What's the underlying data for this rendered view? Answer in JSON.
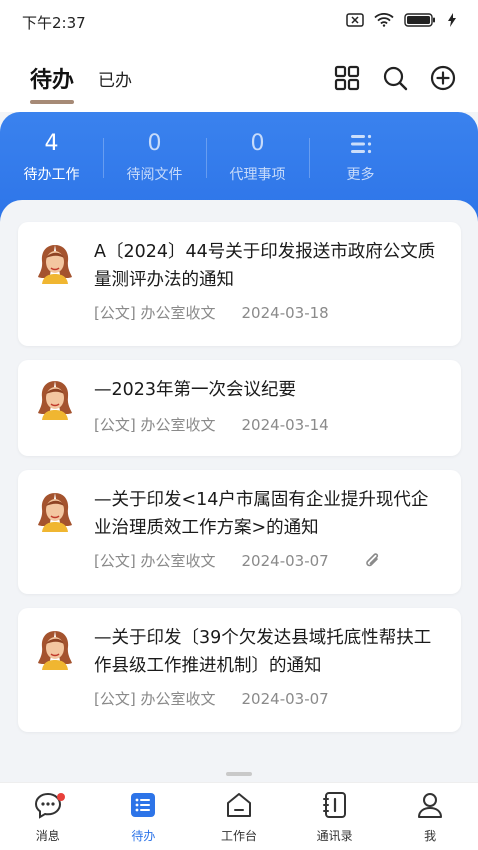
{
  "status": {
    "time": "下午2:37",
    "battery": "100"
  },
  "header": {
    "active_tab": "待办",
    "other_tab": "已办"
  },
  "stats": [
    {
      "value": "4",
      "label": "待办工作",
      "active": true
    },
    {
      "value": "0",
      "label": "待阅文件",
      "active": false
    },
    {
      "value": "0",
      "label": "代理事项",
      "active": false
    },
    {
      "value": "",
      "label": "更多",
      "active": false
    }
  ],
  "items": [
    {
      "title": "A〔2024〕44号关于印发报送市政府公文质量测评办法的通知",
      "type": "[公文]",
      "source": "办公室收文",
      "date": "2024-03-18",
      "attachment": false
    },
    {
      "title": "—2023年第一次会议纪要",
      "type": "[公文]",
      "source": "办公室收文",
      "date": "2024-03-14",
      "attachment": false
    },
    {
      "title": "—关于印发<14户市属固有企业提升现代企业治理质效工作方案>的通知",
      "type": "[公文]",
      "source": "办公室收文",
      "date": "2024-03-07",
      "attachment": true
    },
    {
      "title": "—关于印发〔39个欠发达县域托底性帮扶工作县级工作推进机制〕的通知",
      "type": "[公文]",
      "source": "办公室收文",
      "date": "2024-03-07",
      "attachment": false
    }
  ],
  "nav": [
    {
      "label": "消息",
      "icon": "chat-icon",
      "active": false
    },
    {
      "label": "待办",
      "icon": "list-icon",
      "active": true
    },
    {
      "label": "工作台",
      "icon": "home-icon",
      "active": false
    },
    {
      "label": "通讯录",
      "icon": "contacts-icon",
      "active": false
    },
    {
      "label": "我",
      "icon": "user-icon",
      "active": false
    }
  ],
  "colors": {
    "primary": "#2d74e8",
    "badge": "#e8403a",
    "tab_underline": "#a68a76"
  }
}
